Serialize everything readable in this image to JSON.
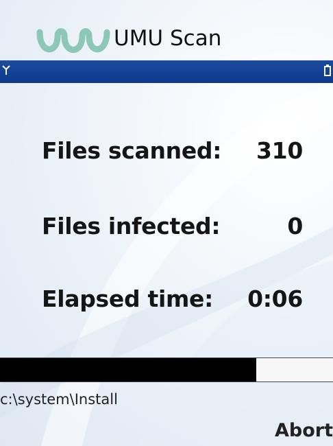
{
  "app": {
    "title": "UMU Scan",
    "logo_icon": "umu-logo-icon"
  },
  "status_bar": {
    "signal_icon": "antenna-icon",
    "battery_icon": "battery-icon",
    "color": "#0d3a8d"
  },
  "stats": [
    {
      "label": "Files scanned:",
      "value": "310"
    },
    {
      "label": "Files infected:",
      "value": "0"
    },
    {
      "label": "Elapsed time:",
      "value": "0:06"
    }
  ],
  "progress": {
    "fraction": 0.77
  },
  "current_path": "c:\\system\\Install",
  "softkey": {
    "label": "Abort"
  }
}
